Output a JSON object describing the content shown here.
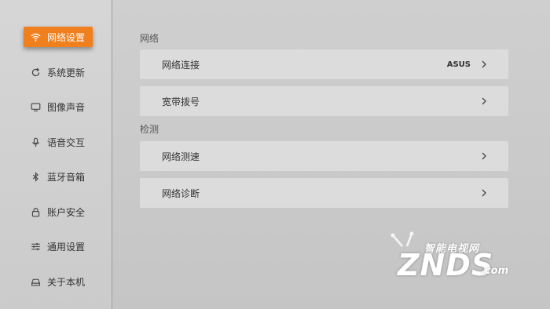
{
  "sidebar": {
    "items": [
      {
        "label": "网络设置",
        "icon": "wifi-icon",
        "active": true
      },
      {
        "label": "系统更新",
        "icon": "refresh-icon"
      },
      {
        "label": "图像声音",
        "icon": "monitor-icon"
      },
      {
        "label": "语音交互",
        "icon": "microphone-icon"
      },
      {
        "label": "蓝牙音箱",
        "icon": "bluetooth-icon"
      },
      {
        "label": "账户安全",
        "icon": "lock-icon"
      },
      {
        "label": "通用设置",
        "icon": "sliders-icon"
      },
      {
        "label": "关于本机",
        "icon": "device-icon"
      }
    ]
  },
  "main": {
    "sections": [
      {
        "title": "网络",
        "rows": [
          {
            "label": "网络连接",
            "value": "ASUS"
          },
          {
            "label": "宽带拨号",
            "value": ""
          }
        ]
      },
      {
        "title": "检测",
        "rows": [
          {
            "label": "网络测速",
            "value": ""
          },
          {
            "label": "网络诊断",
            "value": ""
          }
        ]
      }
    ]
  },
  "watermark": {
    "top_text": "智能电视网",
    "brand": "ZNDS",
    "suffix": ".com"
  },
  "colors": {
    "accent": "#f07f1e",
    "row_bg": "#dcdcdc",
    "sidebar_bg": "#d6d6d6"
  }
}
